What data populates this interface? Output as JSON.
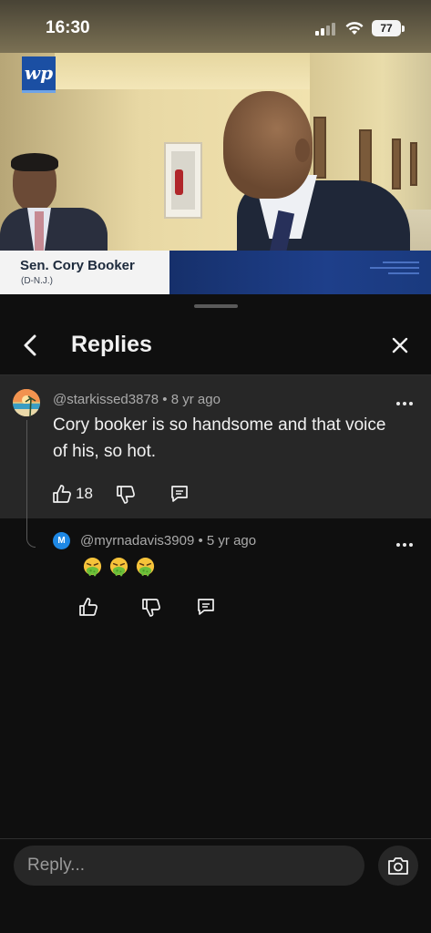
{
  "status_bar": {
    "time": "16:30",
    "battery": "77"
  },
  "video": {
    "logo_text": "wp",
    "lower_third": {
      "name": "Sen. Cory Booker",
      "party": "(D-N.J.)"
    }
  },
  "header": {
    "title": "Replies"
  },
  "parent_comment": {
    "author": "@starkissed3878",
    "separator": "•",
    "age": "8 yr ago",
    "text": "Cory booker is so handsome and that voice of his, so hot.",
    "like_count": "18"
  },
  "reply": {
    "author": "@myrnadavis3909",
    "separator": "•",
    "age": "5 yr ago",
    "avatar_letter": "M",
    "emojis": [
      "🤮",
      "🤮",
      "🤮"
    ]
  },
  "composer": {
    "placeholder": "Reply..."
  },
  "icons": {
    "back": "chevron-left-icon",
    "close": "close-icon",
    "like": "thumbs-up-icon",
    "dislike": "thumbs-down-icon",
    "reply": "comment-icon",
    "more": "more-horizontal-icon",
    "camera": "camera-icon"
  },
  "colors": {
    "sheet_bg": "#0f0f0f",
    "card_bg": "#272727",
    "text_primary": "#f1f1f1",
    "text_secondary": "#aaaaaa",
    "avatar_blue": "#1e88e5",
    "wp_blue": "#1b4fa3"
  }
}
